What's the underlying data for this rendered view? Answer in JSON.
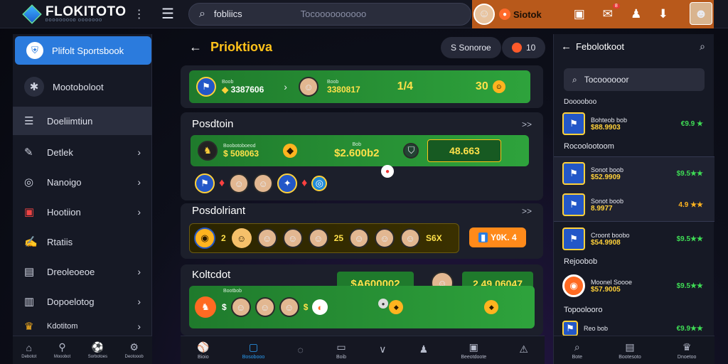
{
  "brand": {
    "title": "FLOKITOTO",
    "subtitle": "DOOOOOOOD OOOOOOO"
  },
  "search": {
    "query": "fobliics",
    "hint": "Tocoooooooooo"
  },
  "header": {
    "status_label": "Siotok",
    "notif_count": "8"
  },
  "sidebar": {
    "items": [
      {
        "label": "Plifolt Sportsbook",
        "icon": "shield-icon"
      },
      {
        "label": "Mootoboloot",
        "icon": "runner-icon"
      },
      {
        "label": "Doeliimtiun",
        "icon": "list-icon"
      },
      {
        "label": "Detlek",
        "icon": "wrench-icon"
      },
      {
        "label": "Nanoigo",
        "icon": "globe-icon"
      },
      {
        "label": "Hootiion",
        "icon": "square-icon"
      },
      {
        "label": "Rtatiis",
        "icon": "edit-icon"
      },
      {
        "label": "Dreoleoeoe",
        "icon": "doc-icon"
      },
      {
        "label": "Dopoelotog",
        "icon": "file-icon"
      },
      {
        "label": "Kdotitom",
        "icon": "trophy-icon"
      }
    ],
    "bottom": [
      "Debotot",
      "Mooobot",
      "Sorbotoes",
      "Deotooob"
    ]
  },
  "main": {
    "title": "Prioktiova",
    "pill_left": "S Sonoroe",
    "pill_right": "10",
    "top_row": {
      "left_label": "Boob",
      "left_val": "3387606",
      "right_label": "Boob",
      "right_val": "3380817",
      "odd1": "1/4",
      "odd2": "30"
    },
    "section1": {
      "title": "Posdtoin",
      "more": ">>",
      "card_label": "Boobotoboeod",
      "card_val": "508063",
      "mid_label": "Bob",
      "mid_val": "$2.600b2",
      "right_val": "48.663"
    },
    "section2": {
      "title": "Posdolriant",
      "more": ">>",
      "row": [
        "2",
        "25",
        "S6X"
      ],
      "btn": "Y0K. 4"
    },
    "section3": {
      "title": "Koltcdot",
      "left_val": "$A600002",
      "right_val": "2.49.06047",
      "card_label": "Bootbob"
    },
    "bottom": [
      "Bioio",
      "Bosobooo",
      "",
      "Boib",
      "",
      "",
      "Beeotdoote",
      ""
    ]
  },
  "right": {
    "title": "Febolotkoot",
    "search": "Tocoooooor",
    "sec1": "Dooooboo",
    "sec2": "Rocoolootoom",
    "sec3": "Rejoobob",
    "sec4": "Topoolooro",
    "items": [
      {
        "name": "Bohteob bob",
        "price": "$88.9903",
        "odd": "€9.9 ★"
      },
      {
        "name": "Sonot boob",
        "price": "$52.9909",
        "odd": "$9.5★★"
      },
      {
        "name": "Sonot boob",
        "price": "8.9977",
        "odd": "4.9 ★★"
      },
      {
        "name": "Croont boobo",
        "price": "$54.9908",
        "odd": "$9.5★★"
      },
      {
        "name": "Moonel Soooe",
        "price": "$57.9005",
        "odd": "$9.5★★"
      },
      {
        "name": "Reo bob",
        "price": "",
        "odd": "€9.9★★"
      }
    ],
    "bottom": [
      "Bote",
      "Bootesoto",
      "Dnoetoo"
    ]
  }
}
